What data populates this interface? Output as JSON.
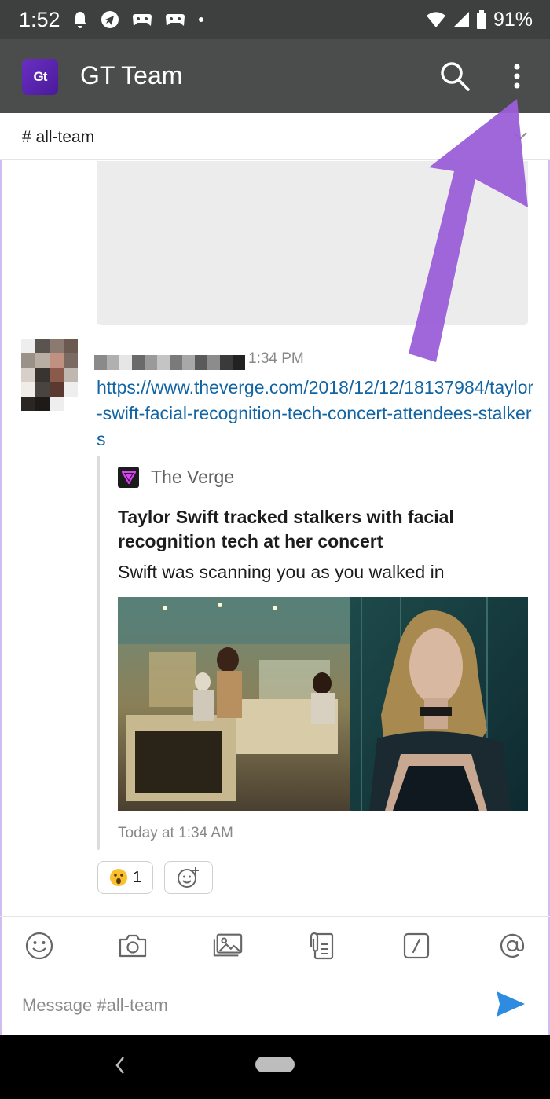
{
  "status_bar": {
    "time": "1:52",
    "battery": "91%",
    "icons": [
      "bell-icon",
      "telegram-icon",
      "game-icon",
      "game-icon",
      "dot-icon",
      "wifi-icon",
      "signal-icon",
      "battery-icon"
    ]
  },
  "app_bar": {
    "logo_text": "Gt",
    "title": "GT Team",
    "color": "#4a4d4b"
  },
  "channel": {
    "name": "# all-team"
  },
  "message": {
    "time": "1:34 PM",
    "link": "https://www.theverge.com/2018/12/12/18137984/taylor-swift-facial-recognition-tech-concert-attendees-stalkers",
    "unfurl": {
      "source": "The Verge",
      "title": "Taylor Swift tracked stalkers with facial recognition tech at her concert",
      "description": "Swift was scanning you as you walked in",
      "footer": "Today at 1:34 AM"
    },
    "reactions": [
      {
        "emoji": "😮",
        "count": "1"
      }
    ]
  },
  "composer": {
    "placeholder": "Message #all-team",
    "tools": [
      "emoji-icon",
      "camera-icon",
      "photo-icon",
      "file-icon",
      "slash-command-icon",
      "mention-icon"
    ]
  },
  "colors": {
    "link": "#1264a3",
    "accent_purple": "#9a5fd8",
    "send": "#2d8ce0"
  }
}
